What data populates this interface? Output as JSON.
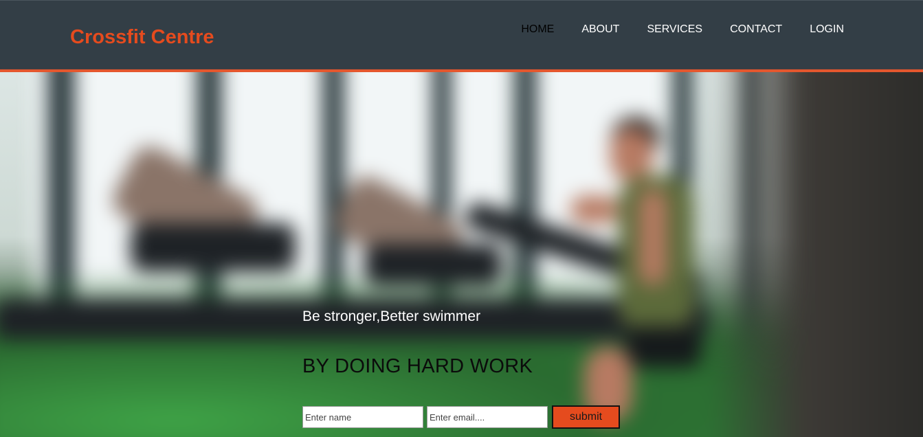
{
  "header": {
    "brand": "Crossfit Centre",
    "nav": [
      {
        "label": "HOME",
        "active": true
      },
      {
        "label": "ABOUT",
        "active": false
      },
      {
        "label": "SERVICES",
        "active": false
      },
      {
        "label": "CONTACT",
        "active": false
      },
      {
        "label": "LOGIN",
        "active": false
      }
    ]
  },
  "hero": {
    "tagline": "Be stronger,Better swimmer",
    "headline": "BY DOING HARD WORK",
    "form": {
      "name_placeholder": "Enter name",
      "email_placeholder": "Enter email....",
      "submit_label": "submit"
    }
  },
  "colors": {
    "header_bg": "#333e46",
    "accent": "#e54b1e",
    "nav_active": "#000000",
    "nav_text": "#ffffff"
  }
}
